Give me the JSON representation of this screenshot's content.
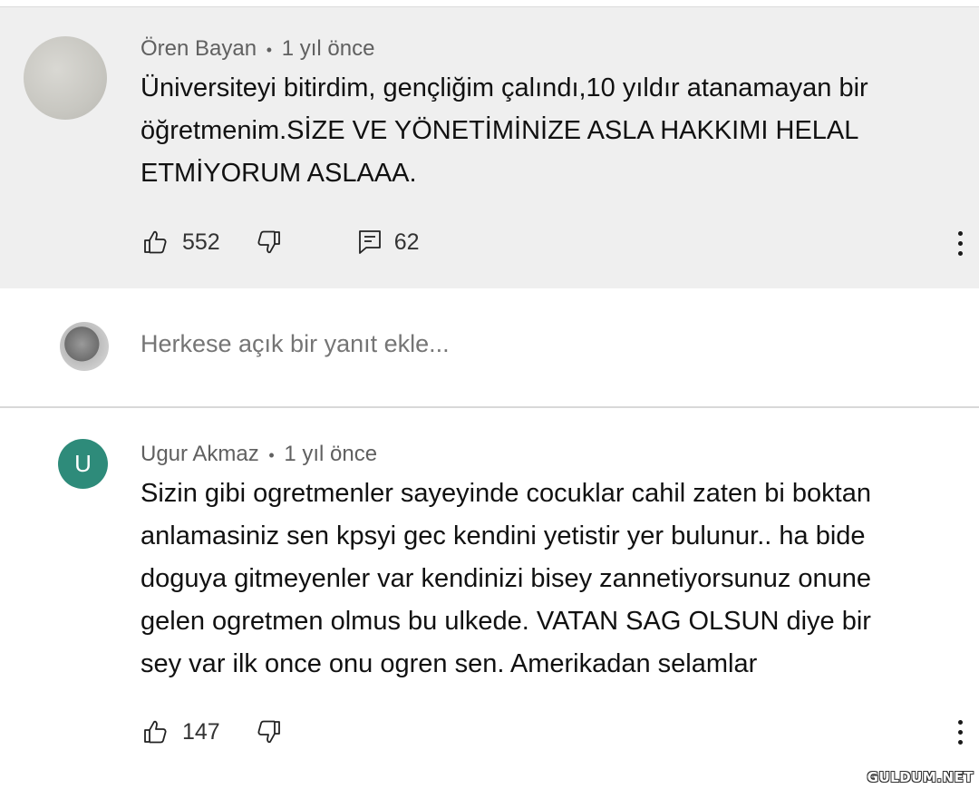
{
  "comments": [
    {
      "author": "Ören Bayan",
      "separator": "•",
      "time": "1 yıl önce",
      "lines": [
        "Üniversiteyi bitirdim, gençliğim çalındı,10 yıldır atanamayan bir",
        "öğretmenim.SİZE VE YÖNETİMİNİZE ASLA HAKKIMI HELAL",
        "ETMİYORUM ASLAAA."
      ],
      "likes": "552",
      "replies": "62"
    },
    {
      "author": "Ugur Akmaz",
      "separator": "•",
      "time": "1 yıl önce",
      "avatar_letter": "U",
      "lines": [
        "Sizin gibi ogretmenler sayeyinde cocuklar cahil zaten bi boktan",
        "anlamasiniz sen kpsyi gec  kendini yetistir yer bulunur.. ha bide",
        "doguya gitmeyenler var  kendinizi bisey zannetiyorsunuz  onune",
        "gelen ogretmen olmus bu ulkede.  VATAN SAG OLSUN diye bir",
        "sey var ilk once onu ogren sen.  Amerikadan selamlar"
      ],
      "likes": "147"
    }
  ],
  "reply": {
    "placeholder": "Herkese açık bir yanıt ekle..."
  },
  "watermark": "GULDUM.NET",
  "icons": {
    "like": "thumbs-up-icon",
    "dislike": "thumbs-down-icon",
    "replies": "comment-icon",
    "more": "more-vert-icon"
  },
  "colors": {
    "highlight_bg": "#efefef",
    "avatar_u": "#2e8b7a",
    "meta": "#606060"
  }
}
